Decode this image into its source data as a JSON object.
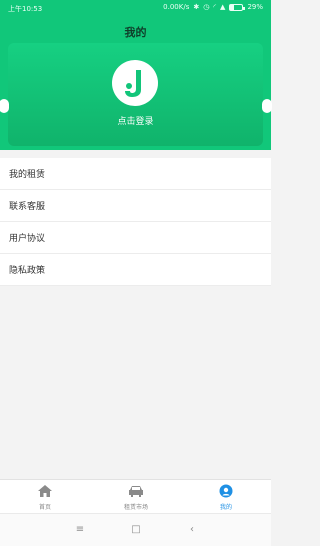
{
  "statusbar": {
    "time": "上午10:53",
    "network": "0.00K/s",
    "battery": "29%"
  },
  "header": {
    "title": "我的"
  },
  "profile": {
    "login_text": "点击登录"
  },
  "menu": {
    "items": [
      {
        "label": "我的租赁"
      },
      {
        "label": "联系客服"
      },
      {
        "label": "用户协议"
      },
      {
        "label": "隐私政策"
      }
    ]
  },
  "tabbar": {
    "tabs": [
      {
        "label": "首页",
        "icon": "home-icon"
      },
      {
        "label": "租赁市场",
        "icon": "car-icon"
      },
      {
        "label": "我的",
        "icon": "profile-icon"
      }
    ],
    "active_color": "#1f90e4"
  },
  "colors": {
    "accent": "#11c77a",
    "background": "#f3f3f3"
  }
}
